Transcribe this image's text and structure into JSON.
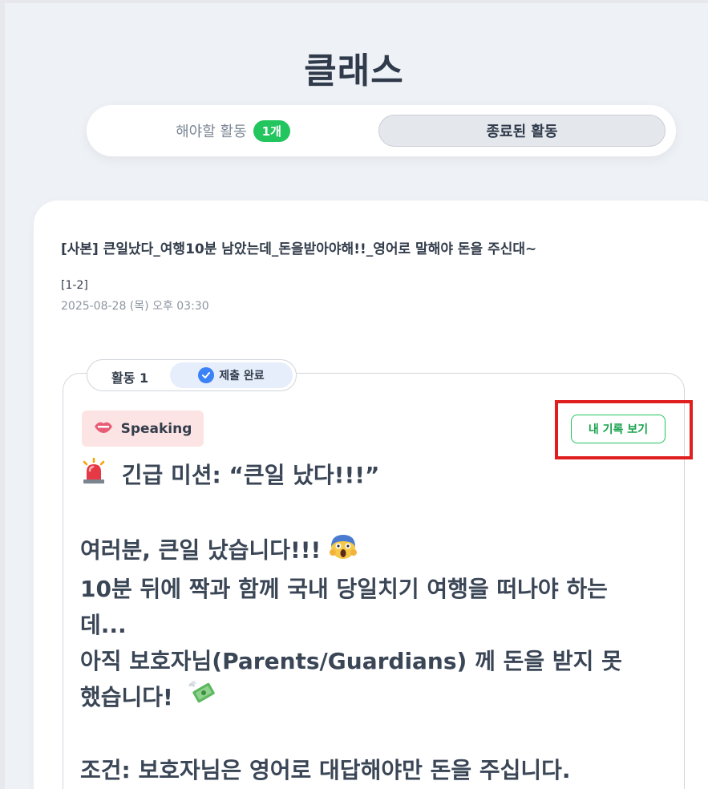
{
  "header": {
    "title": "클래스"
  },
  "tabs": {
    "todo_label": "해야할 활동",
    "todo_count": "1개",
    "done_label": "종료된 활동"
  },
  "card": {
    "title": "[사본] 큰일났다_여행10분 남았는데_돈을받아야해!!_영어로 말해야 돈을 주신대~",
    "class_label": "[1-2]",
    "date": "2025-08-28 (목) 오후 03:30",
    "activity": {
      "label": "활동 1",
      "status": "제출 완료",
      "type_badge": "Speaking",
      "record_button": "내 기록 보기"
    },
    "content": {
      "line1": "긴급 미션: “큰일 났다!!!”",
      "line2": "여러분, 큰일 났습니다!!!",
      "line3": "10분 뒤에 짝과 함께 국내 당일치기 여행을 떠나야 하는",
      "line4": "데...",
      "line5": "아직 보호자님(Parents/Guardians) 께 돈을 받지 못",
      "line6": "했습니다!",
      "line7": "조건: 보호자님은 영어로 대답해야만 돈을 주십니다."
    }
  },
  "icons": {
    "siren": "siren-icon",
    "scream": "screaming-face-icon",
    "money": "money-with-wings-icon",
    "lips": "lips-icon",
    "check": "check-circle-icon"
  },
  "colors": {
    "accent_green": "#22c55e",
    "check_blue": "#3b82f6",
    "badge_pink": "#fde4e4",
    "highlight_red": "#e01e1e"
  }
}
